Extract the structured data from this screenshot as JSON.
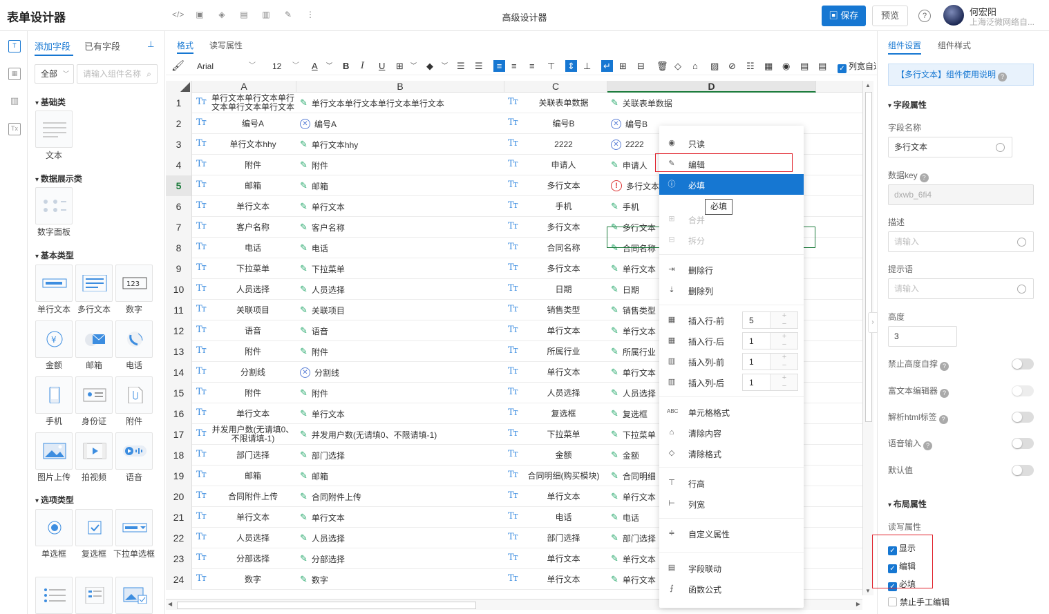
{
  "app": {
    "title": "表单设计器",
    "center_title": "高级设计器",
    "save_label": "保存",
    "preview_label": "预览",
    "help_label": "?"
  },
  "user": {
    "name": "何宏阳",
    "company": "上海泛微网络自..."
  },
  "left_panel": {
    "tabs": [
      "添加字段",
      "已有字段"
    ],
    "filter": {
      "selected": "全部",
      "search_placeholder": "请输入组件名称"
    },
    "categories": [
      {
        "name": "基础类",
        "items": [
          "文本"
        ]
      },
      {
        "name": "数据展示类",
        "items": [
          "数字面板"
        ]
      },
      {
        "name": "基本类型",
        "items": [
          "单行文本",
          "多行文本",
          "数字",
          "金额",
          "邮箱",
          "电话",
          "手机",
          "身份证",
          "附件",
          "图片上传",
          "拍视频",
          "语音"
        ]
      },
      {
        "name": "选项类型",
        "items": [
          "单选框",
          "复选框",
          "下拉单选框"
        ]
      }
    ]
  },
  "main": {
    "tabs": [
      "格式",
      "读写属性"
    ],
    "toolbar": {
      "font": "Arial",
      "size": "12",
      "col_width_label": "列宽自适应"
    },
    "columns": [
      "A",
      "B",
      "C",
      "D"
    ],
    "rows": [
      {
        "n": "1",
        "a": "单行文本单行文本单行文本单行文本单行文本",
        "b": "单行文本单行文本单行文本单行文本",
        "b_icon": "pen",
        "c": "关联表单数据",
        "d": "关联表单数据",
        "d_icon": "pen"
      },
      {
        "n": "2",
        "a": "编号A",
        "b": "编号A",
        "b_icon": "x",
        "c": "编号B",
        "d": "编号B",
        "d_icon": "x"
      },
      {
        "n": "3",
        "a": "单行文本hhy",
        "b": "单行文本hhy",
        "b_icon": "pen",
        "c": "2222",
        "d": "2222",
        "d_icon": "x"
      },
      {
        "n": "4",
        "a": "附件",
        "b": "附件",
        "b_icon": "pen",
        "c": "申请人",
        "d": "申请人",
        "d_icon": "pen"
      },
      {
        "n": "5",
        "a": "邮箱",
        "b": "邮箱",
        "b_icon": "pen",
        "c": "多行文本",
        "d": "多行文本",
        "d_icon": "req"
      },
      {
        "n": "6",
        "a": "单行文本",
        "b": "单行文本",
        "b_icon": "pen",
        "c": "手机",
        "d": "手机",
        "d_icon": "pen"
      },
      {
        "n": "7",
        "a": "客户名称",
        "b": "客户名称",
        "b_icon": "pen",
        "c": "多行文本",
        "d": "多行文本",
        "d_icon": "pen"
      },
      {
        "n": "8",
        "a": "电话",
        "b": "电话",
        "b_icon": "pen",
        "c": "合同名称",
        "d": "合同名称",
        "d_icon": "pen"
      },
      {
        "n": "9",
        "a": "下拉菜单",
        "b": "下拉菜单",
        "b_icon": "pen",
        "c": "多行文本",
        "d": "单行文本",
        "d_icon": "pen"
      },
      {
        "n": "10",
        "a": "人员选择",
        "b": "人员选择",
        "b_icon": "pen",
        "c": "日期",
        "d": "日期",
        "d_icon": "pen"
      },
      {
        "n": "11",
        "a": "关联项目",
        "b": "关联项目",
        "b_icon": "pen",
        "c": "销售类型",
        "d": "销售类型",
        "d_icon": "pen"
      },
      {
        "n": "12",
        "a": "语音",
        "b": "语音",
        "b_icon": "pen",
        "c": "单行文本",
        "d": "单行文本",
        "d_icon": "pen"
      },
      {
        "n": "13",
        "a": "附件",
        "b": "附件",
        "b_icon": "pen",
        "c": "所属行业",
        "d": "所属行业",
        "d_icon": "pen"
      },
      {
        "n": "14",
        "a": "分割线",
        "b": "分割线",
        "b_icon": "x",
        "c": "单行文本",
        "d": "单行文本",
        "d_icon": "pen"
      },
      {
        "n": "15",
        "a": "附件",
        "b": "附件",
        "b_icon": "pen",
        "c": "人员选择",
        "d": "人员选择",
        "d_icon": "pen"
      },
      {
        "n": "16",
        "a": "单行文本",
        "b": "单行文本",
        "b_icon": "pen",
        "c": "复选框",
        "d": "复选框",
        "d_icon": "pen"
      },
      {
        "n": "17",
        "a": "并发用户数(无请填0、不限请填-1)",
        "b": "并发用户数(无请填0、不限请填-1)",
        "b_icon": "pen",
        "c": "下拉菜单",
        "d": "下拉菜单",
        "d_icon": "pen"
      },
      {
        "n": "18",
        "a": "部门选择",
        "b": "部门选择",
        "b_icon": "pen",
        "c": "金额",
        "d": "金额",
        "d_icon": "pen"
      },
      {
        "n": "19",
        "a": "邮箱",
        "b": "邮箱",
        "b_icon": "pen",
        "c": "合同明细(购买模块)",
        "d": "合同明细",
        "d_icon": "pen"
      },
      {
        "n": "20",
        "a": "合同附件上传",
        "b": "合同附件上传",
        "b_icon": "pen",
        "c": "单行文本",
        "d": "单行文本",
        "d_icon": "pen"
      },
      {
        "n": "21",
        "a": "单行文本",
        "b": "单行文本",
        "b_icon": "pen",
        "c": "电话",
        "d": "电话",
        "d_icon": "pen"
      },
      {
        "n": "22",
        "a": "人员选择",
        "b": "人员选择",
        "b_icon": "pen",
        "c": "部门选择",
        "d": "部门选择",
        "d_icon": "pen"
      },
      {
        "n": "23",
        "a": "分部选择",
        "b": "分部选择",
        "b_icon": "pen",
        "c": "单行文本",
        "d": "单行文本",
        "d_icon": "pen"
      },
      {
        "n": "24",
        "a": "数字",
        "b": "数字",
        "b_icon": "pen",
        "c": "单行文本",
        "d": "单行文本",
        "d_icon": "pen"
      }
    ],
    "selected_row": "5"
  },
  "context_menu": {
    "readonly": "只读",
    "edit": "编辑",
    "required": "必填",
    "merge": "合并",
    "split": "拆分",
    "delete_row": "删除行",
    "delete_col": "删除列",
    "insert_row_before": "插入行-前",
    "insert_row_before_val": "5",
    "insert_row_after": "插入行-后",
    "insert_row_after_val": "1",
    "insert_col_before": "插入列-前",
    "insert_col_before_val": "1",
    "insert_col_after": "插入列-后",
    "insert_col_after_val": "1",
    "cell_format": "单元格格式",
    "clear_content": "清除内容",
    "clear_format": "清除格式",
    "row_height": "行高",
    "col_width": "列宽",
    "custom_attr": "自定义属性",
    "field_link": "字段联动",
    "formula": "函数公式",
    "tooltip": "必填"
  },
  "right_panel": {
    "tabs": [
      "组件设置",
      "组件样式"
    ],
    "usage": "【多行文本】组件使用说明",
    "field_section": "字段属性",
    "field_name_label": "字段名称",
    "field_name_value": "多行文本",
    "data_key_label": "数据key",
    "data_key_value": "dxwb_6fi4",
    "desc_label": "描述",
    "desc_placeholder": "请输入",
    "hint_label": "提示语",
    "hint_placeholder": "请输入",
    "height_label": "高度",
    "height_value": "3",
    "toggles": [
      "禁止高度自撑",
      "富文本编辑器",
      "解析html标签",
      "语音输入",
      "默认值"
    ],
    "layout_section": "布局属性",
    "rw_label": "读写属性",
    "checks": [
      "显示",
      "编辑",
      "必填"
    ],
    "manual_edit": "禁止手工编辑"
  },
  "colors": {
    "primary": "#1677d2",
    "selection": "#1a7a3a",
    "highlight_box": "#e0202a"
  }
}
